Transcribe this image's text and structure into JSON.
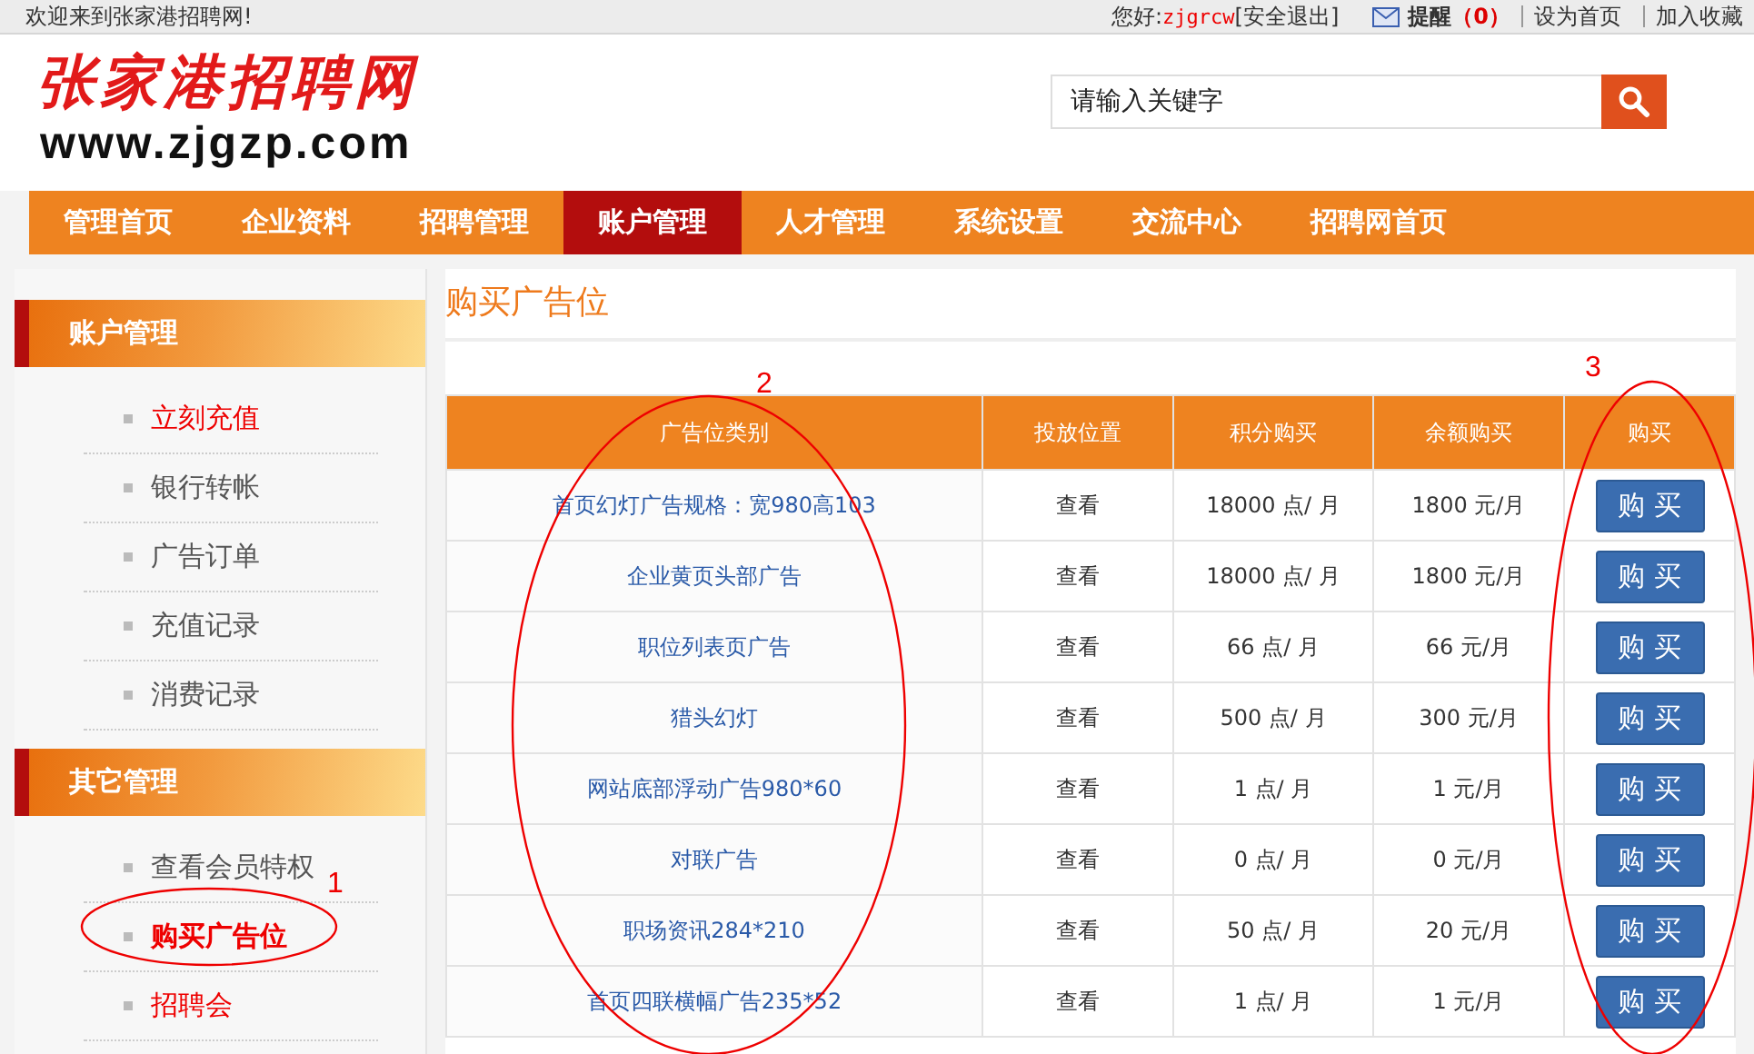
{
  "top_bar": {
    "welcome": "欢迎来到张家港招聘网!",
    "greeting": "您好:",
    "username": "zjgrcw",
    "logout": "[安全退出]",
    "reminder_label": "提醒",
    "reminder_count": "（0）",
    "links": [
      "设为首页",
      "加入收藏"
    ]
  },
  "header": {
    "logo_title": "张家港招聘网",
    "logo_url": "www.zjgzp.com",
    "search": {
      "placeholder": "请输入关键字"
    }
  },
  "nav": [
    {
      "label": "管理首页",
      "selected": false
    },
    {
      "label": "企业资料",
      "selected": false
    },
    {
      "label": "招聘管理",
      "selected": false
    },
    {
      "label": "账户管理",
      "selected": true
    },
    {
      "label": "人才管理",
      "selected": false
    },
    {
      "label": "系统设置",
      "selected": false
    },
    {
      "label": "交流中心",
      "selected": false
    },
    {
      "label": "招聘网首页",
      "selected": false
    }
  ],
  "sidebar": [
    {
      "title": "账户管理",
      "items": [
        {
          "label": "立刻充值",
          "kind": "highlight",
          "selected": false
        },
        {
          "label": "银行转帐",
          "kind": "normal",
          "selected": false
        },
        {
          "label": "广告订单",
          "kind": "normal",
          "selected": false
        },
        {
          "label": "充值记录",
          "kind": "normal",
          "selected": false
        },
        {
          "label": "消费记录",
          "kind": "normal",
          "selected": false
        }
      ]
    },
    {
      "title": "其它管理",
      "items": [
        {
          "label": "查看会员特权",
          "kind": "normal",
          "selected": false
        },
        {
          "label": "购买广告位",
          "kind": "normal",
          "selected": true
        },
        {
          "label": "招聘会",
          "kind": "highlight",
          "selected": false
        }
      ]
    }
  ],
  "page_title": "购买广告位",
  "table": {
    "columns": [
      "广告位类别",
      "投放位置",
      "积分购买",
      "余额购买",
      "购买"
    ],
    "rows": [
      {
        "category": "首页幻灯广告规格：宽980高103",
        "position": "查看",
        "points_price": "18000 点/ 月",
        "balance_price": "1800 元/月",
        "button": "购 买"
      },
      {
        "category": "企业黄页头部广告",
        "position": "查看",
        "points_price": "18000 点/ 月",
        "balance_price": "1800 元/月",
        "button": "购 买"
      },
      {
        "category": "职位列表页广告",
        "position": "查看",
        "points_price": "66 点/ 月",
        "balance_price": "66 元/月",
        "button": "购 买"
      },
      {
        "category": "猎头幻灯",
        "position": "查看",
        "points_price": "500 点/ 月",
        "balance_price": "300 元/月",
        "button": "购 买"
      },
      {
        "category": "网站底部浮动广告980*60",
        "position": "查看",
        "points_price": "1 点/ 月",
        "balance_price": "1 元/月",
        "button": "购 买"
      },
      {
        "category": "对联广告",
        "position": "查看",
        "points_price": "0 点/ 月",
        "balance_price": "0 元/月",
        "button": "购 买"
      },
      {
        "category": "职场资讯284*210",
        "position": "查看",
        "points_price": "50 点/ 月",
        "balance_price": "20 元/月",
        "button": "购 买"
      },
      {
        "category": "首页四联横幅广告235*52",
        "position": "查看",
        "points_price": "1 点/ 月",
        "balance_price": "1 元/月",
        "button": "购 买"
      }
    ]
  },
  "annotations": [
    {
      "label": "1"
    },
    {
      "label": "2"
    },
    {
      "label": "3"
    }
  ]
}
